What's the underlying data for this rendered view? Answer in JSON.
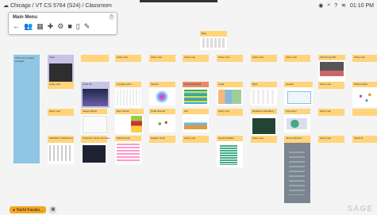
{
  "header": {
    "breadcrumb": "Chicago / VT CS 5764 (S24) / Classroom",
    "time": "01:10 PM",
    "status_icons": [
      "eye-icon",
      "search-icon",
      "help-icon",
      "wifi-icon"
    ]
  },
  "menu": {
    "title": "Main Menu",
    "icons": [
      "back-arrow-icon",
      "users-icon",
      "grid-icon",
      "puzzle-icon",
      "settings-icon",
      "folder-icon",
      "map-icon",
      "pencil-icon"
    ]
  },
  "blue_note": {
    "text": "This is for in-class example"
  },
  "cards": [
    {
      "label": "Blog"
    },
    {
      "label": "Vega"
    },
    {
      "label": "sticky note"
    },
    {
      "label": "sticky note"
    },
    {
      "label": "sticky note"
    },
    {
      "label": "sticky note"
    },
    {
      "label": "sticky note"
    },
    {
      "label": "sticky note"
    },
    {
      "label": "Xiaocheng Wei"
    },
    {
      "label": "sticky note"
    },
    {
      "label": "sticky note"
    },
    {
      "label": "Chao Wu"
    },
    {
      "label": "Longfang Zhu"
    },
    {
      "label": "Samba"
    },
    {
      "label": "Ahmed Elmagdi"
    },
    {
      "label": "Anjali"
    },
    {
      "label": "Bipul"
    },
    {
      "label": "Hassan"
    },
    {
      "label": "sticky note"
    },
    {
      "label": "Patrick Mays"
    },
    {
      "label": "sticky note"
    },
    {
      "label": "Sanjay Bhujel"
    },
    {
      "label": "Ravi Kumar"
    },
    {
      "label": "Nirali Sharma"
    },
    {
      "label": "Siru"
    },
    {
      "label": "sticky note"
    },
    {
      "label": "Deeksha Chaudhari"
    },
    {
      "label": "Chyi-Kwei"
    },
    {
      "label": "sticky note"
    },
    {
      "label": "Siddharth Chakraborty"
    },
    {
      "label": "Prasanth Kumar Chinnam"
    },
    {
      "label": "Nikhil Kumar"
    },
    {
      "label": "Raghav Sethi"
    },
    {
      "label": "sticky note"
    },
    {
      "label": "Harshit Patidar"
    },
    {
      "label": "sticky note"
    },
    {
      "label": "James Marinari"
    },
    {
      "label": "sticky note"
    },
    {
      "label": "Sylvia M"
    }
  ],
  "footer": {
    "user": "Nurbi Karaku...",
    "grid_button": "▦",
    "logo": "SAGE"
  }
}
